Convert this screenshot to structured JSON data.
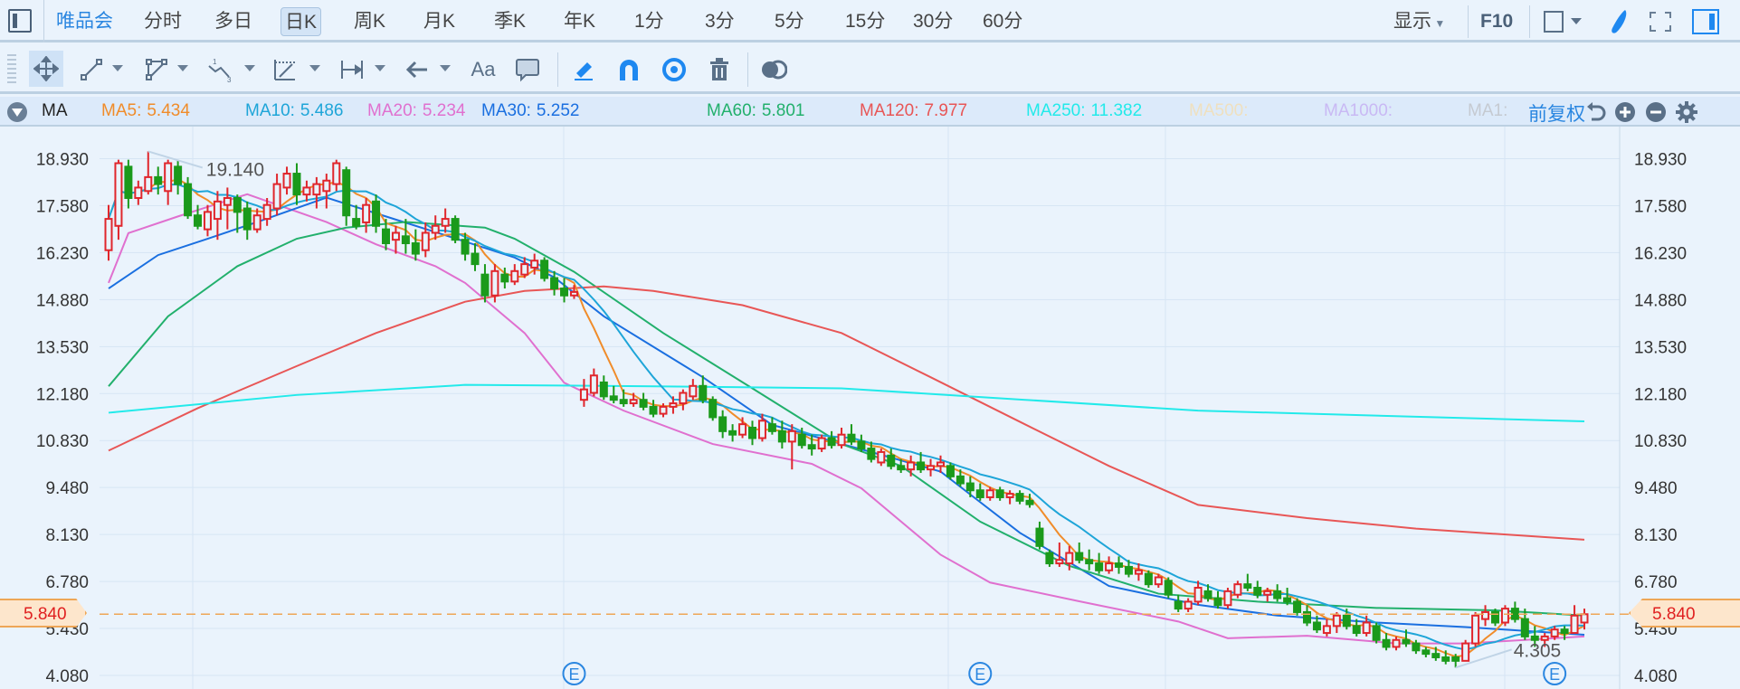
{
  "topbar": {
    "stock_name": "唯品会",
    "periods": [
      "分时",
      "多日",
      "日K",
      "周K",
      "月K",
      "季K",
      "年K",
      "1分",
      "3分",
      "5分",
      "15分",
      "30分",
      "60分"
    ],
    "selected_period": "日K",
    "display_label": "显示",
    "f10_label": "F10"
  },
  "drawing_toolbar": {
    "text_tool_label": "Aa"
  },
  "ma_bar": {
    "indicator": "MA",
    "items": [
      {
        "label": "MA5:",
        "value": "5.434",
        "color": "#f08c2a"
      },
      {
        "label": "MA10:",
        "value": "5.486",
        "color": "#1ea5d8"
      },
      {
        "label": "MA20:",
        "value": "5.234",
        "color": "#e070cf"
      },
      {
        "label": "MA30:",
        "value": "5.252",
        "color": "#1a6fe0"
      },
      {
        "label": "MA60:",
        "value": "5.801",
        "color": "#22b06c"
      },
      {
        "label": "MA120:",
        "value": "7.977",
        "color": "#e85656"
      },
      {
        "label": "MA250:",
        "value": "11.382",
        "color": "#22eaea"
      },
      {
        "label": "MA500:",
        "value": "",
        "color": "#efe0bf"
      },
      {
        "label": "MA1000:",
        "value": "",
        "color": "#c9b9f4"
      },
      {
        "label": "MA1:",
        "value": "",
        "color": "#c5cad1"
      }
    ],
    "adjust_label": "前复权"
  },
  "chart_data": {
    "type": "candlestick",
    "y_ticks": [
      "18.930",
      "17.580",
      "16.230",
      "14.880",
      "13.530",
      "12.180",
      "10.830",
      "9.480",
      "8.130",
      "6.780",
      "5.430",
      "4.080"
    ],
    "ylim": [
      4.08,
      18.93
    ],
    "current_price": "5.840",
    "max_label": "19.140",
    "min_label": "4.305",
    "event_marker": "E",
    "event_indices": [
      47,
      88,
      146
    ],
    "colors": {
      "up": "#e0262c",
      "down": "#1b9a1b",
      "current_line": "#eea656"
    },
    "candles": [
      [
        16.3,
        17.6,
        16.0,
        17.2
      ],
      [
        17.0,
        18.9,
        16.6,
        18.8
      ],
      [
        18.7,
        18.9,
        17.5,
        17.8
      ],
      [
        17.8,
        18.3,
        17.6,
        18.1
      ],
      [
        18.0,
        19.14,
        17.9,
        18.4
      ],
      [
        18.4,
        18.7,
        17.9,
        18.2
      ],
      [
        18.0,
        18.9,
        17.6,
        18.8
      ],
      [
        18.7,
        18.9,
        17.9,
        18.2
      ],
      [
        18.2,
        18.4,
        17.2,
        17.3
      ],
      [
        17.3,
        17.6,
        16.9,
        17.0
      ],
      [
        16.9,
        17.6,
        16.7,
        17.4
      ],
      [
        17.2,
        18.0,
        16.6,
        17.7
      ],
      [
        17.6,
        18.1,
        16.9,
        17.8
      ],
      [
        17.8,
        17.9,
        16.8,
        17.4
      ],
      [
        17.5,
        17.7,
        16.6,
        16.9
      ],
      [
        16.9,
        17.5,
        16.8,
        17.3
      ],
      [
        17.2,
        17.8,
        17.0,
        17.6
      ],
      [
        17.5,
        18.5,
        17.3,
        18.2
      ],
      [
        18.1,
        18.7,
        17.9,
        18.5
      ],
      [
        18.5,
        18.8,
        17.6,
        17.9
      ],
      [
        17.9,
        18.3,
        17.7,
        18.1
      ],
      [
        17.9,
        18.4,
        17.5,
        18.2
      ],
      [
        18.0,
        18.5,
        17.5,
        18.3
      ],
      [
        18.2,
        18.9,
        18.0,
        18.8
      ],
      [
        18.6,
        18.7,
        17.0,
        17.3
      ],
      [
        17.2,
        17.6,
        16.9,
        17.0
      ],
      [
        17.1,
        17.8,
        16.8,
        17.6
      ],
      [
        17.7,
        17.9,
        16.8,
        17.0
      ],
      [
        16.9,
        17.2,
        16.3,
        16.5
      ],
      [
        16.6,
        17.0,
        16.2,
        16.8
      ],
      [
        16.7,
        17.2,
        16.2,
        16.5
      ],
      [
        16.5,
        16.9,
        16.0,
        16.2
      ],
      [
        16.3,
        17.1,
        16.1,
        16.8
      ],
      [
        16.8,
        17.3,
        16.6,
        17.0
      ],
      [
        17.0,
        17.5,
        16.8,
        17.2
      ],
      [
        17.2,
        17.3,
        16.5,
        16.6
      ],
      [
        16.6,
        16.8,
        16.0,
        16.2
      ],
      [
        16.2,
        16.5,
        15.7,
        15.9
      ],
      [
        15.6,
        15.9,
        14.8,
        15.0
      ],
      [
        15.0,
        15.9,
        14.8,
        15.7
      ],
      [
        15.6,
        15.8,
        15.2,
        15.4
      ],
      [
        15.4,
        15.9,
        15.3,
        15.7
      ],
      [
        15.6,
        16.1,
        15.5,
        15.9
      ],
      [
        15.8,
        16.2,
        15.6,
        16.0
      ],
      [
        16.0,
        16.1,
        15.4,
        15.5
      ],
      [
        15.5,
        15.7,
        15.0,
        15.2
      ],
      [
        15.2,
        15.5,
        14.8,
        15.0
      ],
      [
        15.0,
        15.3,
        14.9,
        15.1
      ],
      [
        12.0,
        12.6,
        11.8,
        12.3
      ],
      [
        12.2,
        12.9,
        12.1,
        12.7
      ],
      [
        12.5,
        12.7,
        12.0,
        12.1
      ],
      [
        12.1,
        12.4,
        11.9,
        12.0
      ],
      [
        12.0,
        12.3,
        11.8,
        11.9
      ],
      [
        11.9,
        12.2,
        11.8,
        12.0
      ],
      [
        12.0,
        12.2,
        11.7,
        11.8
      ],
      [
        11.8,
        12.0,
        11.5,
        11.6
      ],
      [
        11.6,
        11.9,
        11.5,
        11.8
      ],
      [
        11.8,
        12.1,
        11.6,
        11.9
      ],
      [
        11.9,
        12.3,
        11.7,
        12.2
      ],
      [
        12.1,
        12.6,
        12.0,
        12.4
      ],
      [
        12.4,
        12.7,
        11.9,
        12.0
      ],
      [
        12.0,
        12.1,
        11.4,
        11.5
      ],
      [
        11.5,
        11.7,
        10.9,
        11.1
      ],
      [
        11.1,
        11.3,
        10.8,
        11.0
      ],
      [
        11.0,
        11.5,
        10.9,
        11.3
      ],
      [
        11.2,
        11.4,
        10.7,
        10.9
      ],
      [
        10.9,
        11.6,
        10.8,
        11.4
      ],
      [
        11.3,
        11.5,
        11.0,
        11.1
      ],
      [
        11.1,
        11.4,
        10.6,
        10.8
      ],
      [
        10.8,
        11.3,
        10.0,
        11.1
      ],
      [
        11.0,
        11.2,
        10.6,
        10.7
      ],
      [
        10.7,
        11.0,
        10.4,
        10.6
      ],
      [
        10.6,
        11.0,
        10.5,
        10.9
      ],
      [
        10.9,
        11.1,
        10.6,
        10.7
      ],
      [
        10.7,
        11.2,
        10.6,
        11.0
      ],
      [
        11.0,
        11.3,
        10.7,
        10.8
      ],
      [
        10.8,
        11.0,
        10.5,
        10.6
      ],
      [
        10.6,
        10.8,
        10.2,
        10.3
      ],
      [
        10.2,
        10.6,
        10.1,
        10.5
      ],
      [
        10.4,
        10.6,
        10.0,
        10.1
      ],
      [
        10.1,
        10.3,
        9.9,
        10.0
      ],
      [
        10.0,
        10.4,
        9.8,
        10.2
      ],
      [
        10.2,
        10.5,
        9.9,
        10.0
      ],
      [
        10.0,
        10.3,
        9.8,
        10.1
      ],
      [
        10.1,
        10.4,
        9.9,
        10.2
      ],
      [
        10.1,
        10.2,
        9.7,
        9.8
      ],
      [
        9.8,
        10.0,
        9.5,
        9.6
      ],
      [
        9.6,
        9.8,
        9.2,
        9.4
      ],
      [
        9.4,
        9.6,
        9.1,
        9.2
      ],
      [
        9.2,
        9.5,
        9.1,
        9.4
      ],
      [
        9.4,
        9.5,
        9.1,
        9.2
      ],
      [
        9.2,
        9.4,
        9.0,
        9.3
      ],
      [
        9.3,
        9.4,
        9.0,
        9.1
      ],
      [
        9.1,
        9.3,
        8.9,
        9.0
      ],
      [
        8.3,
        8.5,
        7.7,
        7.8
      ],
      [
        7.6,
        7.7,
        7.2,
        7.3
      ],
      [
        7.3,
        7.9,
        7.2,
        7.4
      ],
      [
        7.3,
        7.8,
        7.1,
        7.6
      ],
      [
        7.6,
        7.9,
        7.3,
        7.4
      ],
      [
        7.4,
        7.7,
        7.1,
        7.3
      ],
      [
        7.3,
        7.6,
        7.0,
        7.1
      ],
      [
        7.1,
        7.5,
        7.0,
        7.3
      ],
      [
        7.3,
        7.5,
        7.0,
        7.2
      ],
      [
        7.2,
        7.4,
        6.9,
        7.0
      ],
      [
        7.0,
        7.3,
        6.8,
        7.1
      ],
      [
        7.0,
        7.1,
        6.6,
        6.7
      ],
      [
        6.7,
        7.0,
        6.6,
        6.9
      ],
      [
        6.8,
        6.9,
        6.3,
        6.4
      ],
      [
        6.2,
        6.4,
        5.9,
        6.0
      ],
      [
        6.0,
        6.3,
        5.9,
        6.2
      ],
      [
        6.2,
        6.8,
        6.1,
        6.6
      ],
      [
        6.5,
        6.7,
        6.2,
        6.3
      ],
      [
        6.3,
        6.5,
        6.0,
        6.1
      ],
      [
        6.1,
        6.6,
        6.0,
        6.5
      ],
      [
        6.4,
        6.8,
        6.3,
        6.7
      ],
      [
        6.7,
        7.0,
        6.5,
        6.6
      ],
      [
        6.6,
        6.8,
        6.3,
        6.4
      ],
      [
        6.4,
        6.6,
        6.2,
        6.5
      ],
      [
        6.5,
        6.7,
        6.2,
        6.3
      ],
      [
        6.3,
        6.6,
        6.1,
        6.2
      ],
      [
        6.2,
        6.3,
        5.8,
        5.9
      ],
      [
        5.9,
        6.1,
        5.5,
        5.6
      ],
      [
        5.6,
        5.8,
        5.3,
        5.4
      ],
      [
        5.3,
        5.7,
        5.2,
        5.5
      ],
      [
        5.5,
        5.9,
        5.3,
        5.8
      ],
      [
        5.8,
        6.0,
        5.4,
        5.5
      ],
      [
        5.5,
        5.7,
        5.2,
        5.3
      ],
      [
        5.3,
        5.8,
        5.2,
        5.6
      ],
      [
        5.5,
        5.6,
        5.0,
        5.1
      ],
      [
        5.1,
        5.3,
        4.8,
        4.9
      ],
      [
        4.9,
        5.2,
        4.8,
        5.1
      ],
      [
        5.1,
        5.4,
        4.9,
        5.0
      ],
      [
        5.0,
        5.1,
        4.7,
        4.8
      ],
      [
        4.8,
        4.9,
        4.6,
        4.7
      ],
      [
        4.7,
        4.9,
        4.5,
        4.6
      ],
      [
        4.6,
        4.8,
        4.4,
        4.5
      ],
      [
        4.6,
        4.7,
        4.305,
        4.5
      ],
      [
        4.5,
        5.1,
        4.5,
        5.0
      ],
      [
        5.0,
        5.9,
        4.9,
        5.8
      ],
      [
        5.7,
        6.1,
        5.5,
        5.9
      ],
      [
        5.9,
        6.0,
        5.5,
        5.6
      ],
      [
        5.6,
        6.1,
        5.5,
        6.0
      ],
      [
        6.0,
        6.2,
        5.6,
        5.7
      ],
      [
        5.7,
        6.0,
        5.1,
        5.2
      ],
      [
        5.2,
        5.5,
        4.9,
        5.1
      ],
      [
        5.1,
        5.3,
        4.9,
        5.2
      ],
      [
        5.2,
        5.5,
        5.1,
        5.4
      ],
      [
        5.4,
        5.5,
        5.1,
        5.3
      ],
      [
        5.3,
        6.1,
        5.3,
        5.8
      ],
      [
        5.6,
        6.0,
        5.4,
        5.84
      ]
    ],
    "ma_computed": [
      {
        "name": "MA5",
        "period": 5,
        "color": "#f08c2a"
      },
      {
        "name": "MA10",
        "period": 10,
        "color": "#1ea5d8"
      }
    ],
    "ma_sparse": [
      {
        "name": "MA20",
        "color": "#e070cf",
        "points": [
          [
            0,
            15.36
          ],
          [
            2,
            16.79
          ],
          [
            7,
            17.27
          ],
          [
            14,
            17.91
          ],
          [
            22,
            17.11
          ],
          [
            27,
            16.47
          ],
          [
            33,
            15.84
          ],
          [
            36,
            15.36
          ],
          [
            42,
            13.92
          ],
          [
            46,
            12.49
          ],
          [
            52,
            11.69
          ],
          [
            61,
            10.73
          ],
          [
            71,
            10.16
          ],
          [
            76,
            9.46
          ],
          [
            84,
            7.55
          ],
          [
            89,
            6.75
          ],
          [
            98,
            6.21
          ],
          [
            108,
            5.63
          ],
          [
            113,
            5.15
          ],
          [
            121,
            5.22
          ],
          [
            130,
            5.0
          ],
          [
            137,
            5.0
          ],
          [
            149,
            5.2
          ]
        ]
      },
      {
        "name": "MA30",
        "color": "#1a6fe0",
        "points": [
          [
            0,
            15.2
          ],
          [
            5,
            16.16
          ],
          [
            10,
            16.63
          ],
          [
            15,
            17.11
          ],
          [
            22,
            17.81
          ],
          [
            28,
            17.27
          ],
          [
            34,
            16.73
          ],
          [
            41,
            16.09
          ],
          [
            45,
            15.52
          ],
          [
            50,
            14.4
          ],
          [
            60,
            12.65
          ],
          [
            67,
            11.28
          ],
          [
            78,
            10.42
          ],
          [
            84,
            9.94
          ],
          [
            92,
            8.18
          ],
          [
            101,
            6.65
          ],
          [
            110,
            6.11
          ],
          [
            118,
            5.8
          ],
          [
            128,
            5.6
          ],
          [
            137,
            5.47
          ],
          [
            149,
            5.25
          ]
        ]
      },
      {
        "name": "MA60",
        "color": "#22b06c",
        "points": [
          [
            0,
            12.39
          ],
          [
            6,
            14.4
          ],
          [
            13,
            15.84
          ],
          [
            19,
            16.63
          ],
          [
            24,
            16.95
          ],
          [
            30,
            17.11
          ],
          [
            38,
            16.95
          ],
          [
            41,
            16.63
          ],
          [
            47,
            15.68
          ],
          [
            56,
            13.92
          ],
          [
            65,
            12.33
          ],
          [
            74,
            10.73
          ],
          [
            80,
            10.1
          ],
          [
            88,
            8.5
          ],
          [
            97,
            7.23
          ],
          [
            106,
            6.43
          ],
          [
            116,
            6.2
          ],
          [
            128,
            6.02
          ],
          [
            140,
            5.95
          ],
          [
            149,
            5.8
          ]
        ]
      },
      {
        "name": "MA120",
        "color": "#e85656",
        "points": [
          [
            0,
            10.54
          ],
          [
            9,
            11.76
          ],
          [
            19,
            12.97
          ],
          [
            27,
            13.92
          ],
          [
            36,
            14.82
          ],
          [
            42,
            15.13
          ],
          [
            50,
            15.26
          ],
          [
            55,
            15.13
          ],
          [
            64,
            14.72
          ],
          [
            74,
            13.92
          ],
          [
            83,
            12.65
          ],
          [
            92,
            11.37
          ],
          [
            101,
            10.1
          ],
          [
            110,
            8.98
          ],
          [
            121,
            8.6
          ],
          [
            132,
            8.3
          ],
          [
            149,
            7.98
          ]
        ]
      },
      {
        "name": "MA250",
        "color": "#22eaea",
        "points": [
          [
            0,
            11.63
          ],
          [
            19,
            12.14
          ],
          [
            36,
            12.43
          ],
          [
            55,
            12.39
          ],
          [
            74,
            12.33
          ],
          [
            92,
            12.01
          ],
          [
            110,
            11.69
          ],
          [
            149,
            11.38
          ]
        ]
      }
    ]
  }
}
